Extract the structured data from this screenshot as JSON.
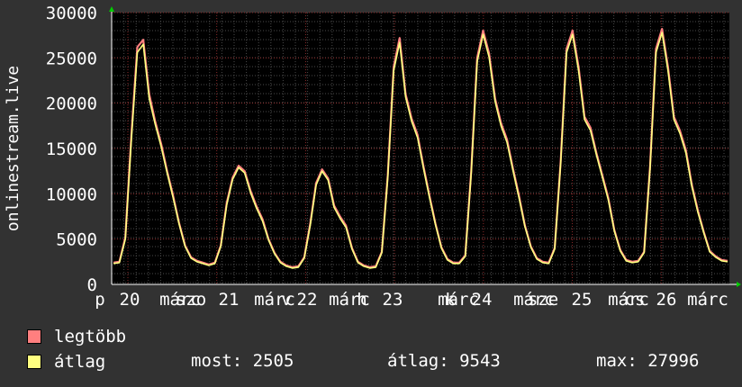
{
  "chart_data": {
    "type": "line",
    "ylabel": "onlinestream.live",
    "ylim": [
      0,
      30000
    ],
    "yticks": [
      0,
      5000,
      10000,
      15000,
      20000,
      25000,
      30000
    ],
    "grid": true,
    "x_tick_labels": [
      "p",
      "20",
      "márc",
      "szo",
      "21",
      "márc",
      "v",
      "22",
      "márc",
      "h",
      "23",
      "márc",
      "k",
      "24",
      "márc",
      "sze",
      "25",
      "márc",
      "cs",
      "26",
      "márc"
    ],
    "series": [
      {
        "name": "legtöbb",
        "color": "#ff7f7f",
        "values": [
          2400,
          2500,
          5200,
          16500,
          26200,
          27000,
          21000,
          18000,
          15500,
          12500,
          9800,
          6800,
          4300,
          3000,
          2600,
          2400,
          2200,
          2400,
          4300,
          9000,
          11800,
          13100,
          12500,
          10300,
          8600,
          7200,
          5000,
          3500,
          2500,
          2100,
          1900,
          2000,
          3000,
          6700,
          11200,
          12700,
          11700,
          8700,
          7500,
          6500,
          4000,
          2500,
          2100,
          1900,
          2000,
          3600,
          12000,
          24000,
          27200,
          21000,
          18300,
          16500,
          13000,
          9800,
          6700,
          4100,
          2800,
          2400,
          2400,
          3200,
          12500,
          25000,
          28000,
          25500,
          20500,
          17800,
          16000,
          12800,
          9800,
          6500,
          4200,
          2900,
          2500,
          2400,
          4000,
          13500,
          26000,
          28000,
          24000,
          18500,
          17300,
          14500,
          12000,
          9500,
          6000,
          3800,
          2700,
          2500,
          2600,
          3600,
          13000,
          26000,
          28200,
          24000,
          18500,
          17000,
          14800,
          11000,
          8200,
          5800,
          3700,
          3100,
          2700,
          2600
        ]
      },
      {
        "name": "átlag",
        "color": "#ffff80",
        "values": [
          2300,
          2400,
          5000,
          16000,
          25600,
          26500,
          20500,
          17700,
          15200,
          12300,
          9600,
          6700,
          4200,
          2900,
          2500,
          2300,
          2100,
          2300,
          4200,
          8800,
          11600,
          12900,
          12300,
          10100,
          8400,
          7000,
          4900,
          3400,
          2400,
          2000,
          1800,
          1900,
          2900,
          6500,
          11000,
          12500,
          11500,
          8500,
          7300,
          6300,
          3900,
          2400,
          2000,
          1800,
          1900,
          3500,
          11800,
          23600,
          26700,
          20700,
          18000,
          16200,
          12800,
          9600,
          6600,
          4000,
          2700,
          2300,
          2300,
          3100,
          12300,
          24600,
          27600,
          25100,
          20200,
          17500,
          15700,
          12600,
          9600,
          6400,
          4100,
          2800,
          2400,
          2300,
          3900,
          13300,
          25600,
          27600,
          23600,
          18200,
          17000,
          14300,
          11800,
          9300,
          5900,
          3700,
          2600,
          2400,
          2500,
          3500,
          12800,
          25600,
          27800,
          23600,
          18200,
          16700,
          14500,
          10800,
          8000,
          5700,
          3600,
          3000,
          2600,
          2505
        ]
      }
    ]
  },
  "legend": {
    "items": [
      {
        "label": "legtöbb",
        "color": "#ff7f7f"
      },
      {
        "label": "átlag",
        "color": "#ffff80"
      }
    ]
  },
  "stats": {
    "current": "most: 2505",
    "average": "átlag: 9543",
    "maximum": "max: 27996"
  }
}
